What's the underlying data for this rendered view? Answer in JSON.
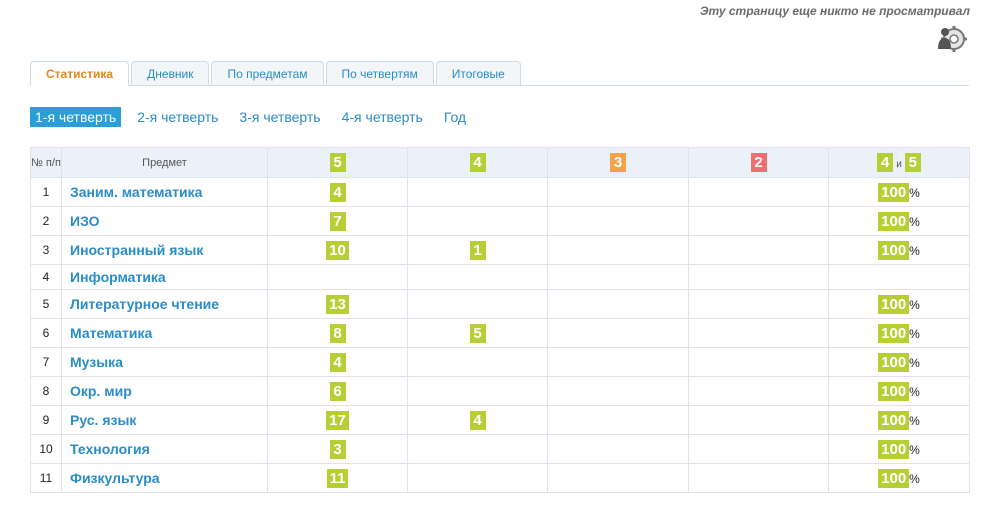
{
  "header": {
    "views_note": "Эту страницу еще никто не просматривал",
    "viewer_icon": "gear-person-icon"
  },
  "tabs": [
    {
      "label": "Статистика",
      "active": true
    },
    {
      "label": "Дневник",
      "active": false
    },
    {
      "label": "По предметам",
      "active": false
    },
    {
      "label": "По четвертям",
      "active": false
    },
    {
      "label": "Итоговые",
      "active": false
    }
  ],
  "quarters": [
    {
      "label": "1-я четверть",
      "active": true
    },
    {
      "label": "2-я четверть",
      "active": false
    },
    {
      "label": "3-я четверть",
      "active": false
    },
    {
      "label": "4-я четверть",
      "active": false
    },
    {
      "label": "Год",
      "active": false
    }
  ],
  "table": {
    "headers": {
      "num": "№ п/п",
      "subject": "Предмет",
      "g5": "5",
      "g4": "4",
      "g3": "3",
      "g2": "2",
      "g45_a": "4",
      "g45_and": "и",
      "g45_b": "5"
    },
    "colors": {
      "grade5": "#b5cf34",
      "grade4": "#b5cf34",
      "grade3": "#f4a248",
      "grade2": "#ef6e6e"
    },
    "rows": [
      {
        "num": "1",
        "subject": "Заним. математика",
        "g5": "4",
        "g4": "",
        "g3": "",
        "g2": "",
        "pct": "100",
        "pct_sign": "%"
      },
      {
        "num": "2",
        "subject": "ИЗО",
        "g5": "7",
        "g4": "",
        "g3": "",
        "g2": "",
        "pct": "100",
        "pct_sign": "%"
      },
      {
        "num": "3",
        "subject": "Иностранный язык",
        "g5": "10",
        "g4": "1",
        "g3": "",
        "g2": "",
        "pct": "100",
        "pct_sign": "%"
      },
      {
        "num": "4",
        "subject": "Информатика",
        "g5": "",
        "g4": "",
        "g3": "",
        "g2": "",
        "pct": "",
        "pct_sign": ""
      },
      {
        "num": "5",
        "subject": "Литературное чтение",
        "g5": "13",
        "g4": "",
        "g3": "",
        "g2": "",
        "pct": "100",
        "pct_sign": "%"
      },
      {
        "num": "6",
        "subject": "Математика",
        "g5": "8",
        "g4": "5",
        "g3": "",
        "g2": "",
        "pct": "100",
        "pct_sign": "%"
      },
      {
        "num": "7",
        "subject": "Музыка",
        "g5": "4",
        "g4": "",
        "g3": "",
        "g2": "",
        "pct": "100",
        "pct_sign": "%"
      },
      {
        "num": "8",
        "subject": "Окр. мир",
        "g5": "6",
        "g4": "",
        "g3": "",
        "g2": "",
        "pct": "100",
        "pct_sign": "%"
      },
      {
        "num": "9",
        "subject": "Рус. язык",
        "g5": "17",
        "g4": "4",
        "g3": "",
        "g2": "",
        "pct": "100",
        "pct_sign": "%"
      },
      {
        "num": "10",
        "subject": "Технология",
        "g5": "3",
        "g4": "",
        "g3": "",
        "g2": "",
        "pct": "100",
        "pct_sign": "%"
      },
      {
        "num": "11",
        "subject": "Физкультура",
        "g5": "11",
        "g4": "",
        "g3": "",
        "g2": "",
        "pct": "100",
        "pct_sign": "%"
      }
    ]
  }
}
